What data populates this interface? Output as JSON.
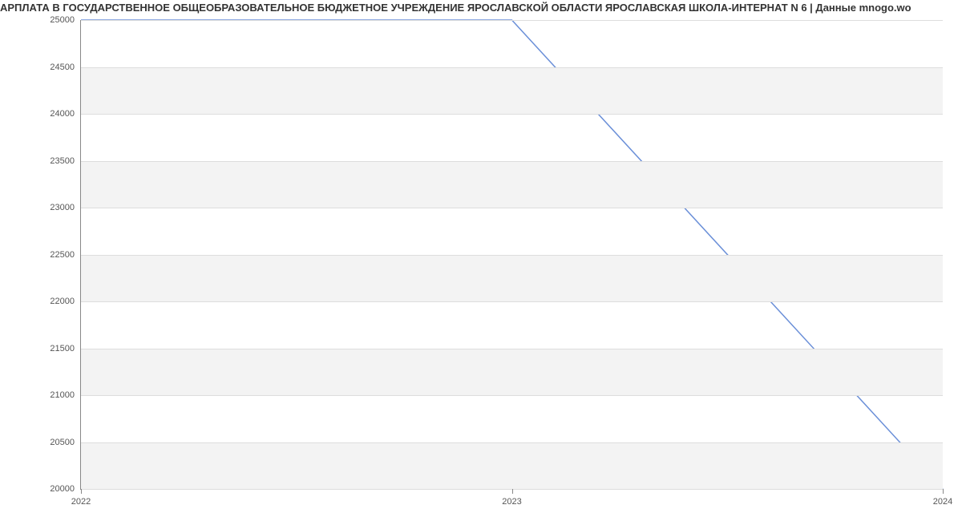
{
  "chart_data": {
    "type": "line",
    "title": "АРПЛАТА В ГОСУДАРСТВЕННОЕ ОБЩЕОБРАЗОВАТЕЛЬНОЕ БЮДЖЕТНОЕ УЧРЕЖДЕНИЕ ЯРОСЛАВСКОЙ ОБЛАСТИ ЯРОСЛАВСКАЯ ШКОЛА-ИНТЕРНАТ N 6 | Данные mnogo.wo",
    "x": [
      2022,
      2023,
      2024
    ],
    "values": [
      25000,
      25000,
      20000
    ],
    "xlim": [
      2022,
      2024
    ],
    "ylim": [
      20000,
      25000
    ],
    "xticks": [
      2022,
      2023,
      2024
    ],
    "yticks": [
      20000,
      20500,
      21000,
      21500,
      22000,
      22500,
      23000,
      23500,
      24000,
      24500,
      25000
    ],
    "xlabel": "",
    "ylabel": "",
    "line_color": "#6a8fd8"
  }
}
